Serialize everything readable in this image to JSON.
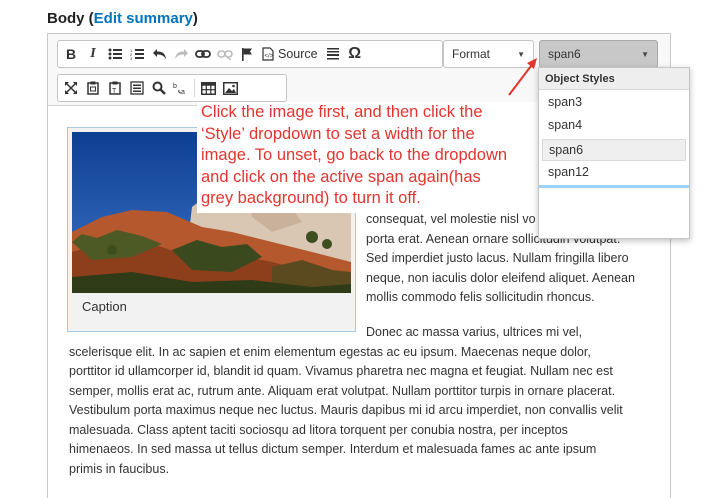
{
  "field": {
    "label": "Body",
    "edit_link": "Edit summary"
  },
  "toolbar": {
    "row1": [
      "bold",
      "italic",
      "bulleted-list",
      "numbered-list",
      "undo",
      "redo",
      "link",
      "unlink",
      "anchor"
    ],
    "source_label": "Source",
    "format_label": "Format",
    "style_label": "span6"
  },
  "dropdown": {
    "heading": "Object Styles",
    "items": [
      "span3",
      "span4",
      "span6",
      "span12"
    ],
    "active": "span6"
  },
  "figure": {
    "caption": "Caption"
  },
  "content": {
    "para1_lines": [
      "consequat, vel molestie nisl vo",
      "porta erat. Aenean ornare sollicitudin volutpat.",
      "Sed imperdiet justo lacus. Nullam fringilla libero",
      "neque, non iaculis dolor eleifend aliquet. Aenean",
      "mollis commodo felis sollicitudin rhoncus."
    ],
    "para2_lines": [
      "Donec ac massa varius, ultrices mi vel,",
      "scelerisque elit. In ac sapien et enim elementum egestas ac eu ipsum. Maecenas neque dolor,",
      "porttitor id ullamcorper id, blandit id quam. Vivamus pharetra nec magna et feugiat. Nullam nec est",
      "semper, mollis erat ac, rutrum ante. Aliquam erat volutpat. Nullam porttitor turpis in ornare placerat.",
      "Vestibulum porta maximus neque nec luctus. Mauris dapibus mi id arcu imperdiet, non convallis velit",
      "malesuada. Class aptent taciti sociosqu ad litora torquent per conubia nostra, per inceptos",
      "himenaeos. In sed massa ut tellus dictum semper. Interdum et malesuada fames ac ante ipsum",
      "primis in faucibus."
    ]
  },
  "annotation": {
    "lines": [
      "Click the image first, and then click the",
      "‘Style’ dropdown to set a width for the",
      "image. To unset, go back to the dropdown",
      "and click on the active span again(has",
      "grey background) to turn it off."
    ],
    "color": "#e4342e"
  }
}
